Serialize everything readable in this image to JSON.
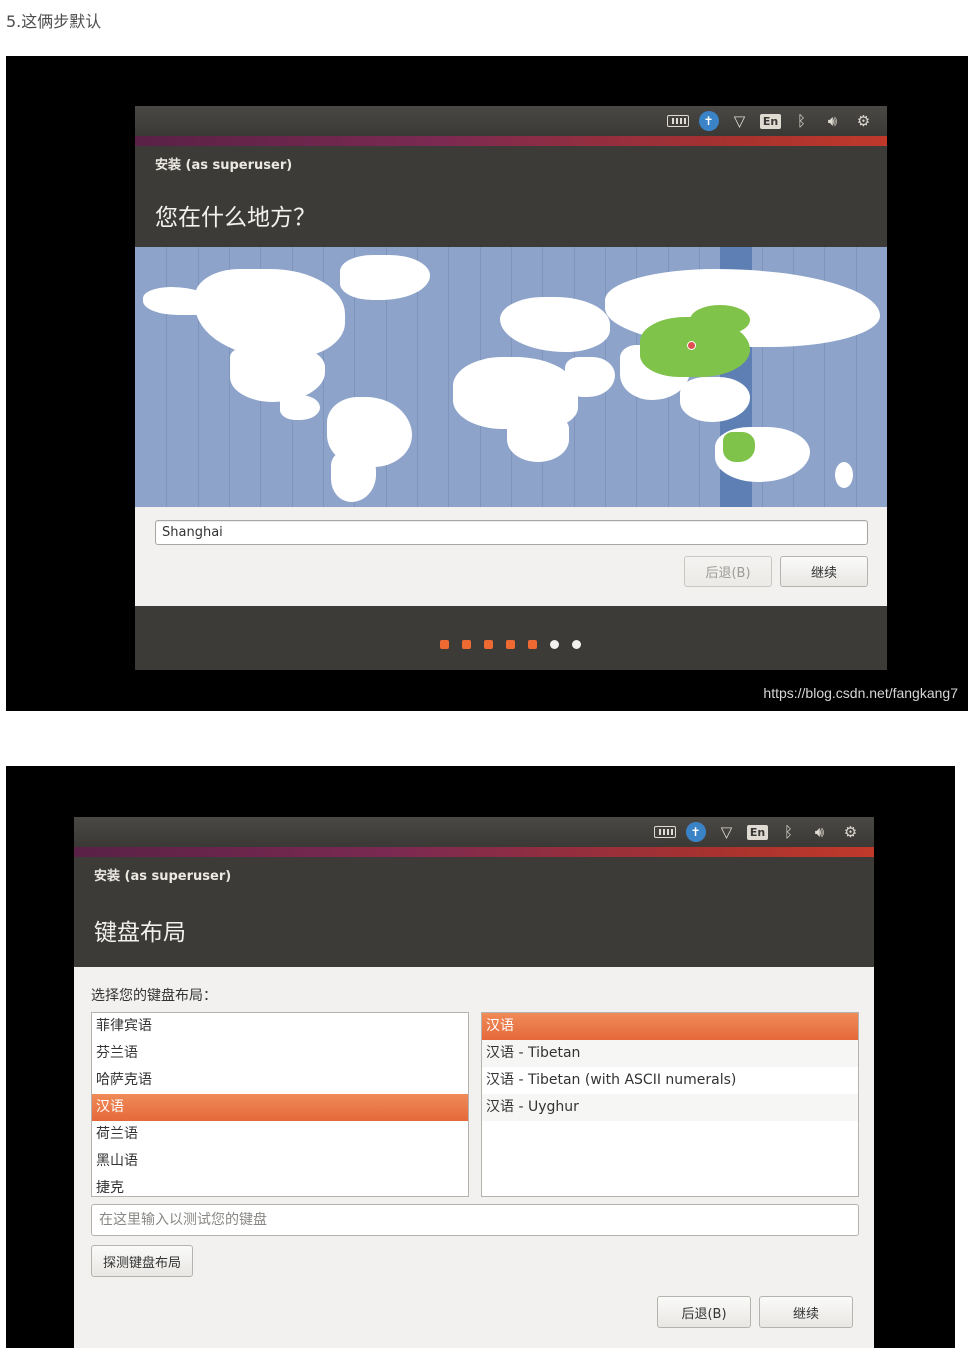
{
  "caption": "5.这俩步默认",
  "tray_icons": [
    "keyboard-icon",
    "accessibility-icon",
    "wifi-icon",
    "language-indicator",
    "bluetooth-icon",
    "volume-icon",
    "settings-gear-icon"
  ],
  "tray_lang": "En",
  "colors": {
    "accent_orange": "#e5683a",
    "header_dark": "#3c3b37",
    "map_sea": "#8da3c9",
    "map_highlight_land": "#7fc34a"
  },
  "screen1": {
    "window_title": "安装 (as superuser)",
    "page_title": "您在什么地方？",
    "timezone_value": "Shanghai",
    "back_button": "后退(B)",
    "continue_button": "继续",
    "progress": {
      "total": 7,
      "completed": 5
    },
    "watermark": "https://blog.csdn.net/fangkang7"
  },
  "screen2": {
    "window_title": "安装 (as superuser)",
    "page_title": "键盘布局",
    "prompt": "选择您的键盘布局：",
    "layouts": [
      "菲律宾语",
      "芬兰语",
      "哈萨克语",
      "汉语",
      "荷兰语",
      "黑山语",
      "捷克"
    ],
    "selected_layout": "汉语",
    "variants": [
      "汉语",
      "汉语 - Tibetan",
      "汉语 - Tibetan (with ASCII numerals)",
      "汉语 - Uyghur"
    ],
    "selected_variant": "汉语",
    "test_placeholder": "在这里输入以测试您的键盘",
    "detect_button": "探测键盘布局",
    "back_button": "后退(B)",
    "continue_button": "继续"
  }
}
